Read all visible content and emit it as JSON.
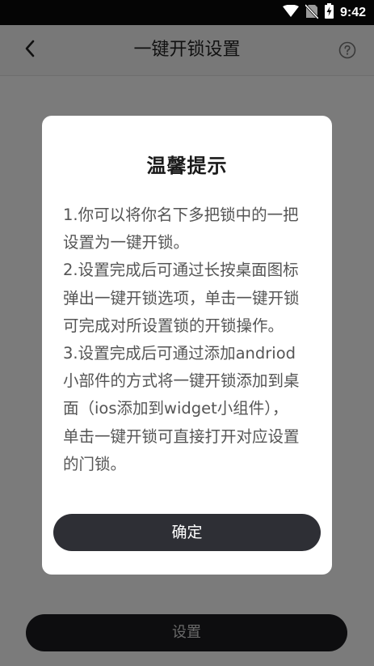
{
  "status_bar": {
    "time": "9:42",
    "icons": [
      "wifi-icon",
      "no-sim-icon",
      "battery-charging-icon"
    ]
  },
  "app_bar": {
    "title": "一键开锁设置",
    "back_icon": "chevron-left-icon",
    "help_icon": "help-circle-icon"
  },
  "bottom": {
    "button_label": "设置"
  },
  "dialog": {
    "title": "温馨提示",
    "lines": [
      "1.你可以将你名下多把锁中的一把",
      "设置为一键开锁。",
      "2.设置完成后可通过长按桌面图标",
      "弹出一键开锁选项，单击一键开锁",
      "可完成对所设置锁的开锁操作。",
      "3.设置完成后可通过添加andriod",
      "小部件的方式将一键开锁添加到桌",
      "面（ios添加到widget小组件），",
      "单击一键开锁可直接打开对应设置",
      "的门锁。"
    ],
    "confirm_label": "确定"
  },
  "colors": {
    "overlay_bg": "#7b7b7b",
    "dialog_bg": "#ffffff",
    "confirm_bg": "#2e2f35",
    "status_bar_bg": "#050505"
  }
}
